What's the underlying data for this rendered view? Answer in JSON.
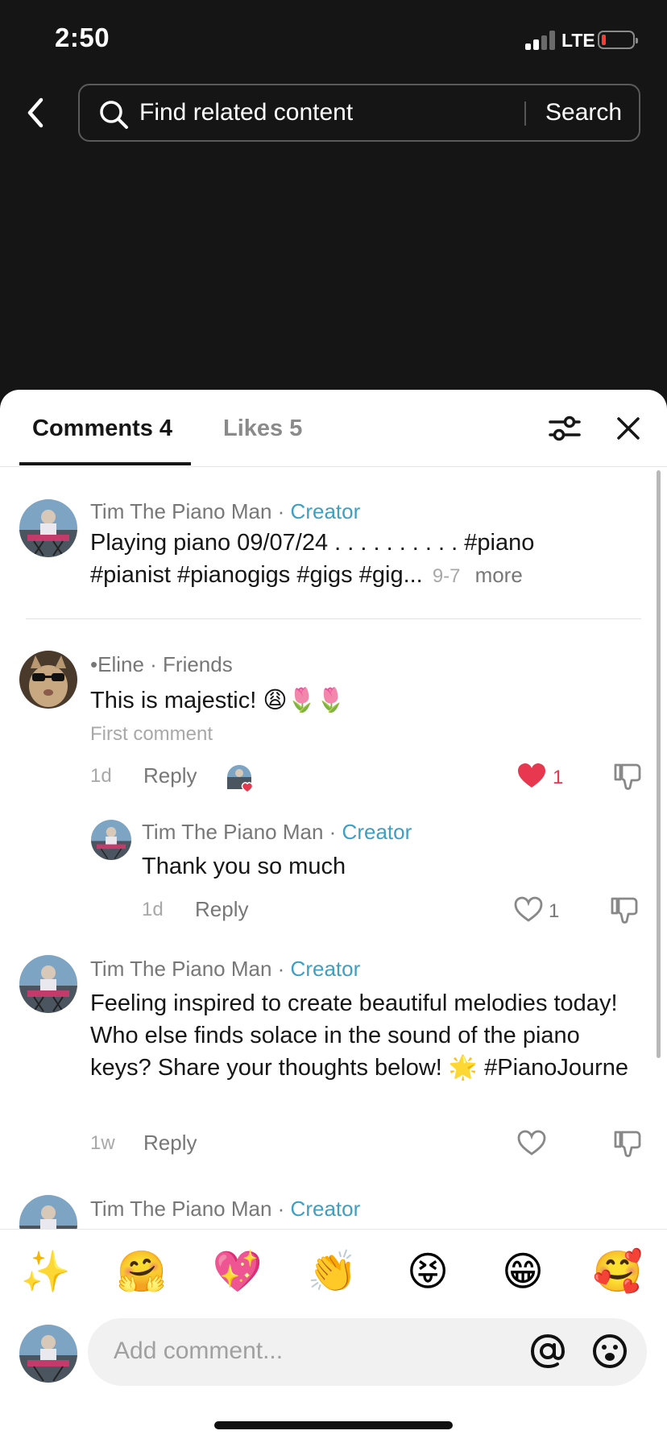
{
  "status_bar": {
    "time": "2:50",
    "network": "LTE"
  },
  "search": {
    "placeholder": "Find related content",
    "button_label": "Search"
  },
  "tabs": {
    "comments": "Comments 4",
    "likes": "Likes 5"
  },
  "caption": {
    "author": "Tim The Piano Man",
    "separator": " · ",
    "badge": "Creator",
    "text_line1": "Playing piano 09/07/24 . . . . . . . . . . #piano",
    "text_line2": "#pianist #pianogigs #gigs #gig...",
    "date": "9-7",
    "more_label": "more"
  },
  "comments": [
    {
      "author": "•Eline",
      "relation": " · Friends",
      "text": "This is majestic! 😩🌷🌷",
      "tag": "First comment",
      "age": "1d",
      "reply_label": "Reply",
      "likes": "1",
      "liked": true
    },
    {
      "author": "Tim The Piano Man",
      "separator": " · ",
      "badge": "Creator",
      "text": "Thank you so much",
      "age": "1d",
      "reply_label": "Reply",
      "likes": "1"
    },
    {
      "author": "Tim The Piano Man",
      "separator": " · ",
      "badge": "Creator",
      "text": "Feeling inspired to create beautiful melodies today! Who else finds solace in the sound of the piano keys? Share your thoughts below! 🌟 #PianoJourne",
      "age": "1w",
      "reply_label": "Reply"
    },
    {
      "author": "Tim The Piano Man",
      "separator": " · ",
      "badge": "Creator"
    }
  ],
  "emoji_bar": [
    "✨",
    "🤗",
    "💖",
    "👏",
    "😝",
    "😁",
    "🥰"
  ],
  "comment_input": {
    "placeholder": "Add comment..."
  },
  "colors": {
    "accent_creator": "#3d9fc2",
    "like_red": "#e8384f",
    "background_dark": "#151515"
  }
}
